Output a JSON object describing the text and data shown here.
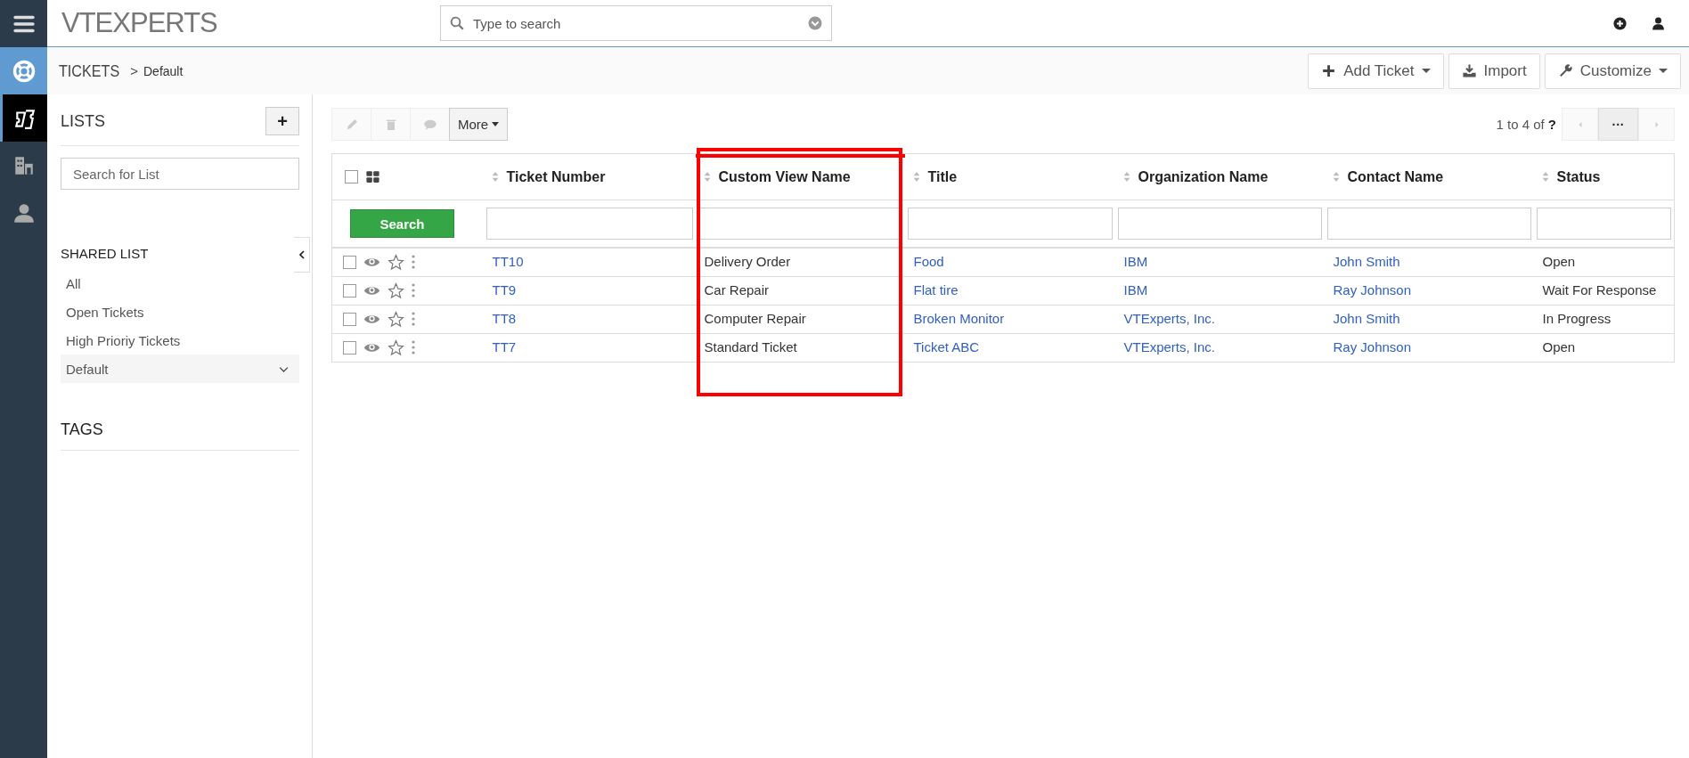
{
  "rail": {
    "items": [
      {
        "selected": false
      },
      {
        "selected": true
      },
      {
        "selected": false
      },
      {
        "selected": false
      }
    ]
  },
  "topbar": {
    "logo": "VTEXPERTS",
    "search": {
      "placeholder": "Type to search"
    }
  },
  "breadcrumb": {
    "module": "TICKETS",
    "separator": ">",
    "view": "Default"
  },
  "header_actions": [
    {
      "label": "Add Ticket",
      "kind": "add"
    },
    {
      "label": "Import",
      "kind": "import"
    },
    {
      "label": "Customize",
      "kind": "customize"
    }
  ],
  "sidebar": {
    "lists_title": "LISTS",
    "add_button": "+",
    "search": {
      "placeholder": "Search for List"
    },
    "shared_title": "SHARED LIST",
    "items": [
      {
        "label": "All",
        "selected": false
      },
      {
        "label": "Open Tickets",
        "selected": false
      },
      {
        "label": "High Prioriy Tickets",
        "selected": false
      },
      {
        "label": "Default",
        "selected": true
      }
    ],
    "tags_title": "TAGS"
  },
  "toolbar": {
    "more": "More"
  },
  "pagination": {
    "range": "1 to 4",
    "of": "of",
    "total": "?",
    "more": "···"
  },
  "table": {
    "select_all_checked": false,
    "search_button": "Search",
    "columns": [
      {
        "label": "Ticket Number",
        "link": true,
        "highlighted": false
      },
      {
        "label": "Custom View Name",
        "link": false,
        "highlighted": true
      },
      {
        "label": "Title",
        "link": true,
        "highlighted": false
      },
      {
        "label": "Organization Name",
        "link": true,
        "highlighted": false
      },
      {
        "label": "Contact Name",
        "link": true,
        "highlighted": false
      },
      {
        "label": "Status",
        "link": false,
        "highlighted": false
      }
    ],
    "rows": [
      {
        "checked": false,
        "starred": false,
        "cells": [
          "TT10",
          "Delivery Order",
          "Food",
          "IBM",
          "John Smith",
          "Open"
        ]
      },
      {
        "checked": false,
        "starred": false,
        "cells": [
          "TT9",
          "Car Repair",
          "Flat tire",
          "IBM",
          "Ray Johnson",
          "Wait For Response"
        ]
      },
      {
        "checked": false,
        "starred": false,
        "cells": [
          "TT8",
          "Computer Repair",
          "Broken Monitor",
          "VTExperts, Inc.",
          "John Smith",
          "In Progress"
        ]
      },
      {
        "checked": false,
        "starred": false,
        "cells": [
          "TT7",
          "Standard Ticket",
          "Ticket ABC",
          "VTExperts, Inc.",
          "Ray Johnson",
          "Open"
        ]
      }
    ]
  }
}
